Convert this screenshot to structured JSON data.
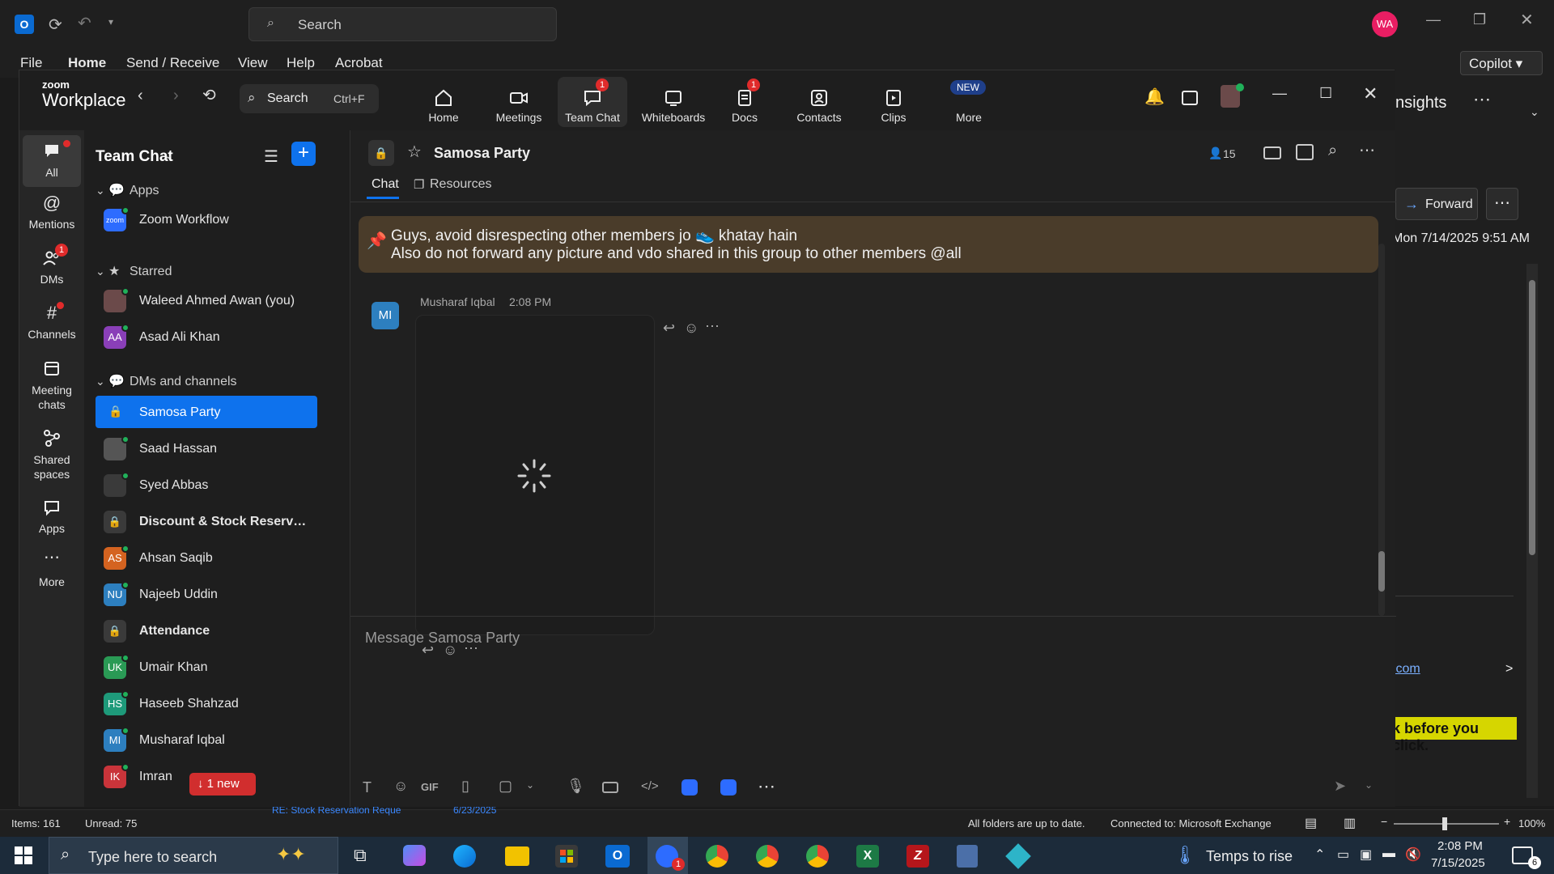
{
  "outlook": {
    "search_placeholder": "Search",
    "avatar_initials": "WA",
    "menu": [
      "File",
      "Home",
      "Send / Receive",
      "View",
      "Help",
      "Acrobat"
    ],
    "copilot_label": "Copilot",
    "insights_label": "nsights",
    "forward_label": "Forward",
    "date_text": "Mon 7/14/2025 9:51 AM",
    "link_fragment": ".com",
    "warning_fragment": "k before you click.",
    "behind_subject": "RE: Stock Reservation Reque",
    "behind_date": "6/23/2025",
    "status": {
      "items": "Items: 161",
      "unread": "Unread: 75",
      "sync": "All folders are up to date.",
      "connected": "Connected to: Microsoft Exchange",
      "zoom": "100%"
    }
  },
  "taskbar": {
    "search_placeholder": "Type here to search",
    "weather": "Temps to rise",
    "time": "2:08 PM",
    "date": "7/15/2025",
    "notifications": "6",
    "zoom_badge": "1"
  },
  "zoom": {
    "brand_top": "zoom",
    "brand_bottom": "Workplace",
    "search_label": "Search",
    "search_shortcut": "Ctrl+F",
    "tabs": [
      {
        "label": "Home",
        "icon": "home-icon"
      },
      {
        "label": "Meetings",
        "icon": "video-icon"
      },
      {
        "label": "Team Chat",
        "icon": "chat-icon",
        "badge": "1"
      },
      {
        "label": "Whiteboards",
        "icon": "whiteboard-icon"
      },
      {
        "label": "Docs",
        "icon": "docs-icon",
        "badge": "1"
      },
      {
        "label": "Contacts",
        "icon": "contacts-icon"
      },
      {
        "label": "Clips",
        "icon": "clips-icon"
      },
      {
        "label": "More",
        "icon": "more-icon",
        "tag": "NEW"
      }
    ],
    "rail": [
      {
        "label": "All",
        "icon": "chat-bubble-icon"
      },
      {
        "label": "Mentions",
        "icon": "at-icon"
      },
      {
        "label": "DMs",
        "icon": "people-icon",
        "badge": "1"
      },
      {
        "label": "Channels",
        "icon": "hash-icon"
      },
      {
        "label": "Meeting\nchats",
        "icon": "calendar-icon"
      },
      {
        "label": "Shared\nspaces",
        "icon": "share-icon"
      },
      {
        "label": "Apps",
        "icon": "apps-icon"
      },
      {
        "label": "More",
        "icon": "more-dots-icon"
      }
    ],
    "sidebar": {
      "title": "Team Chat",
      "sections": {
        "apps": "Apps",
        "starred": "Starred",
        "dms": "DMs and channels"
      },
      "apps_items": [
        {
          "name": "Zoom Workflow",
          "initials": "zoom",
          "color": "#2d6cff"
        }
      ],
      "starred_items": [
        {
          "name": "Waleed Ahmed Awan (you)",
          "initials": "",
          "color": "#6b4a4a"
        },
        {
          "name": "Asad Ali Khan",
          "initials": "AA",
          "color": "#8a3fb8"
        }
      ],
      "dm_items": [
        {
          "name": "Samosa Party",
          "type": "channel",
          "selected": true
        },
        {
          "name": "Saad Hassan",
          "initials": "",
          "color": "#555555"
        },
        {
          "name": "Syed Abbas",
          "initials": "",
          "color": "#3a3a3a"
        },
        {
          "name": "Discount & Stock Reserva...",
          "type": "channel",
          "bold": true
        },
        {
          "name": "Ahsan Saqib",
          "initials": "AS",
          "color": "#d46320"
        },
        {
          "name": "Najeeb Uddin",
          "initials": "NU",
          "color": "#2d7fbf"
        },
        {
          "name": "Attendance",
          "type": "channel",
          "bold": true
        },
        {
          "name": "Umair Khan",
          "initials": "UK",
          "color": "#2a9a55"
        },
        {
          "name": "Haseeb Shahzad",
          "initials": "HS",
          "color": "#1e9a7a"
        },
        {
          "name": "Musharaf Iqbal",
          "initials": "MI",
          "color": "#2d7fbf"
        },
        {
          "name": "Imran",
          "initials": "IK",
          "color": "#c9343a"
        }
      ],
      "new_pill": "1 new"
    },
    "chat": {
      "title": "Samosa Party",
      "member_count": "15",
      "tabs": [
        "Chat",
        "Resources"
      ],
      "pinned_line1": "Guys, avoid disrespecting other members jo 👟 khatay hain",
      "pinned_line2": "Also do not forward any picture and vdo shared in this group to other members @all",
      "message": {
        "sender": "Musharaf Iqbal",
        "time": "2:08 PM",
        "initials": "MI"
      },
      "composer_placeholder": "Message Samosa Party",
      "gif_label": "GIF"
    }
  },
  "colors": {
    "accent": "#0e72ed",
    "badge": "#e02b2b",
    "online": "#20b15a",
    "pinned_bg": "#4a3c2a"
  }
}
